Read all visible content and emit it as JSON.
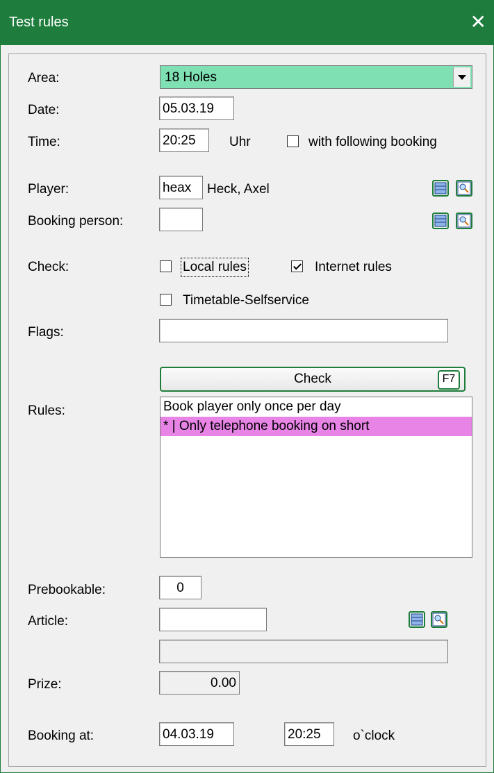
{
  "window": {
    "title": "Test rules",
    "close_glyph": "✕"
  },
  "area": {
    "label": "Area:",
    "value": "18 Holes"
  },
  "date": {
    "label": "Date:",
    "value": "05.03.19"
  },
  "time": {
    "label": "Time:",
    "value": "20:25",
    "unit": "Uhr",
    "following_label": "with following booking",
    "following_checked": false
  },
  "player": {
    "label": "Player:",
    "code": "heax",
    "name": "Heck, Axel"
  },
  "booking_person": {
    "label": "Booking person:",
    "code": ""
  },
  "check": {
    "label": "Check:",
    "local_rules": "Local rules",
    "local_checked": false,
    "internet_rules": "Internet rules",
    "internet_checked": true,
    "timetable": "Timetable-Selfservice",
    "timetable_checked": false
  },
  "flags": {
    "label": "Flags:",
    "value": ""
  },
  "check_button": {
    "label": "Check",
    "shortcut": "F7"
  },
  "rules": {
    "label": "Rules:",
    "items": [
      "Book player only once per day",
      "* | Only telephone booking on short"
    ]
  },
  "prebookable": {
    "label": "Prebookable:",
    "value": "0"
  },
  "article": {
    "label": "Article:",
    "value": "",
    "description": ""
  },
  "prize": {
    "label": "Prize:",
    "value": "0.00"
  },
  "booking_at": {
    "label": "Booking at:",
    "date": "04.03.19",
    "time": "20:25",
    "unit": "o`clock"
  },
  "colors": {
    "titlebar": "#1e7d3c",
    "area_bg": "#7fe0b3",
    "highlight": "#e784e6"
  }
}
